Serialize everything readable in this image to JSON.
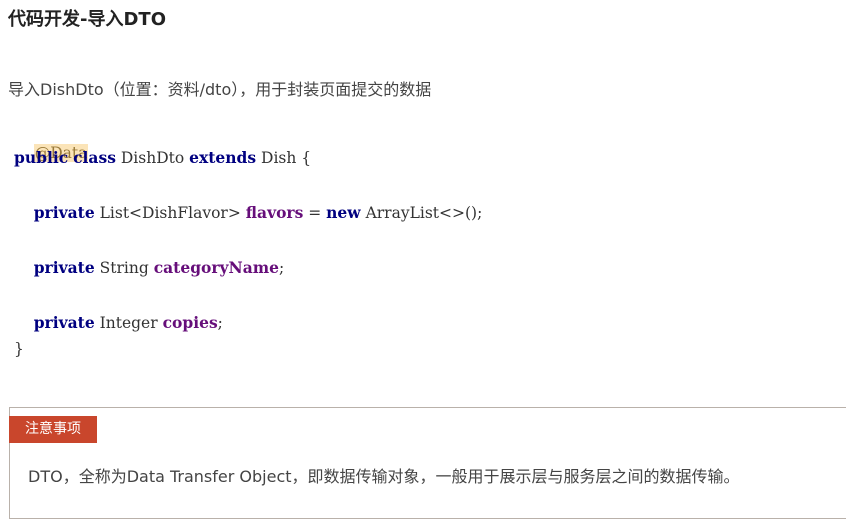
{
  "heading": "代码开发-导入DTO",
  "intro_text": "导入DishDto（位置：资料/dto），用于封装页面提交的数据",
  "code": {
    "annotation": "@Data",
    "line1": {
      "kw1": "public",
      "kw2": "class",
      "name": "DishDto",
      "kw3": "extends",
      "parent": "Dish {"
    },
    "line2": {
      "kw": "private",
      "type": "List<DishFlavor>",
      "field": "flavors",
      "eq": " = ",
      "kw_new": "new",
      "rest": " ArrayList<>();"
    },
    "line3": {
      "kw": "private",
      "type": "String",
      "field": "categoryName",
      "end": ";"
    },
    "line4": {
      "kw": "private",
      "type": "Integer",
      "field": "copies",
      "end": ";"
    },
    "closing": "}"
  },
  "note": {
    "tag": "注意事项",
    "text": "DTO，全称为Data Transfer Object，即数据传输对象，一般用于展示层与服务层之间的数据传输。"
  },
  "colors": {
    "keyword": "#000080",
    "field": "#660e7a",
    "annotation_bg": "#fbe4b8",
    "note_tag_bg": "#c9462c"
  }
}
